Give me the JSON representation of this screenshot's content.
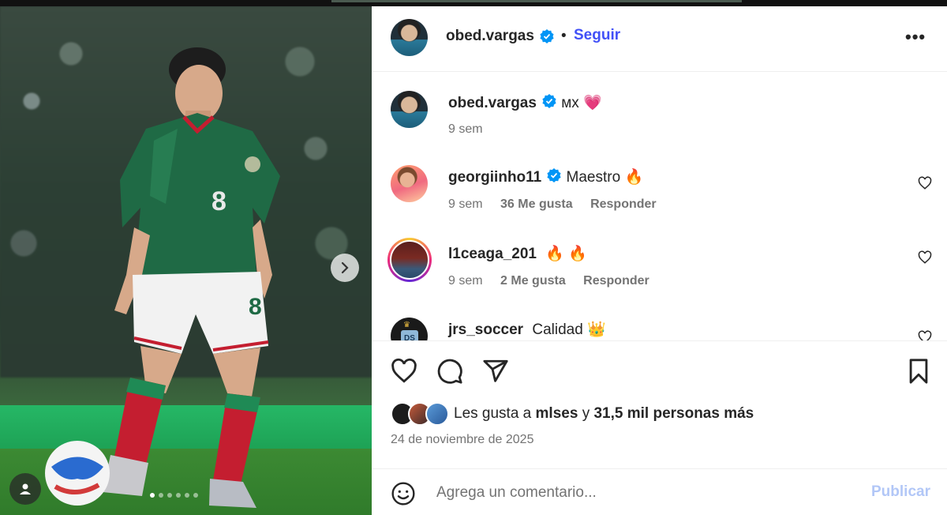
{
  "colors": {
    "accent": "#4150f7",
    "verified": "#0095f6",
    "muted": "#737373",
    "publish_disabled": "#b2c7f7",
    "heart": "#ff3040"
  },
  "media": {
    "icons": {
      "next": "chevron-right-icon",
      "tag": "user-tag-icon"
    },
    "carousel_count": 6,
    "carousel_active": 0
  },
  "header": {
    "username": "obed.vargas",
    "separator": "•",
    "follow_label": "Seguir",
    "more_label": "•••"
  },
  "comments": [
    {
      "username": "obed.vargas",
      "verified": true,
      "text": "ᴍx 💗",
      "time": "9 sem"
    },
    {
      "username": "georgiinho11",
      "verified": true,
      "text": "Maestro 🔥",
      "time": "9 sem",
      "likes": "36 Me gusta",
      "reply": "Responder"
    },
    {
      "username": "l1ceaga_201",
      "verified": false,
      "text": "🔥 🔥",
      "time": "9 sem",
      "likes": "2 Me gusta",
      "reply": "Responder"
    },
    {
      "username": "jrs_soccer",
      "verified": false,
      "text": "Calidad 👑"
    }
  ],
  "actions": {
    "icons": [
      "heart-icon",
      "comment-icon",
      "share-icon",
      "bookmark-icon"
    ]
  },
  "likes_summary": {
    "prefix": "Les gusta a",
    "user": "mlses",
    "mid": "y",
    "rest": "31,5 mil personas más"
  },
  "date": "24 de noviembre de 2025",
  "compose": {
    "placeholder": "Agrega un comentario...",
    "publish_label": "Publicar"
  }
}
